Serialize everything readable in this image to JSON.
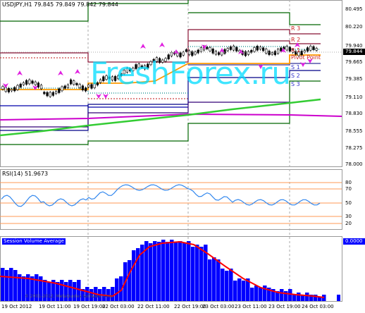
{
  "price_panel": {
    "title": "USDJPY,H1  79.845 79.849 79.842 79.844",
    "current_price": "79.844",
    "axis_labels": [
      "80.495",
      "80.220",
      "79.940",
      "79.665",
      "79.385",
      "79.110",
      "78.830",
      "78.555",
      "78.275",
      "78.000"
    ],
    "level_labels": [
      {
        "text": "R 3",
        "color": "#cc2222"
      },
      {
        "text": "R 2",
        "color": "#cc2222"
      },
      {
        "text": "R 1",
        "color": "#cc2222"
      },
      {
        "text": "Pivot Point",
        "color": "#cc2222"
      },
      {
        "text": "S 1",
        "color": "#3333cc"
      },
      {
        "text": "S 2",
        "color": "#3333cc"
      },
      {
        "text": "S 3",
        "color": "#3333cc"
      }
    ]
  },
  "watermark": {
    "text": "FreshForex.ru",
    "color": "#00ddff"
  },
  "rsi_panel": {
    "title": "RSI(14) 51.9673",
    "axis_labels": [
      "80",
      "70",
      "50",
      "30",
      "20"
    ]
  },
  "histogram_panel": {
    "title": "Session Volume Average",
    "value_tag": "0.0000",
    "copyright": "© 2001-2012, MetaQuotes Software Corp."
  },
  "time_axis": [
    "19 Oct 2012",
    "19 Oct 11:00",
    "19 Oct 19:00",
    "22 Oct 03:00",
    "22 Oct 11:00",
    "22 Oct 19:00",
    "23 Oct 03:00",
    "23 Oct 11:00",
    "23 Oct 19:00",
    "24 Oct 03:00"
  ],
  "colors": {
    "background": "#ffffff",
    "grid": "#c0c0c0",
    "separator": "#999999",
    "candle": "#000000",
    "arrow_marker": "#e020e0",
    "orange_line": "#ff9900",
    "purple_line": "#cc00cc",
    "green_ma": "#33cc33",
    "rsi_line": "#3388ee",
    "rsi_levels": "#ff9955",
    "histogram_bars": "#0000ff",
    "histogram_line": "#ff0000"
  }
}
